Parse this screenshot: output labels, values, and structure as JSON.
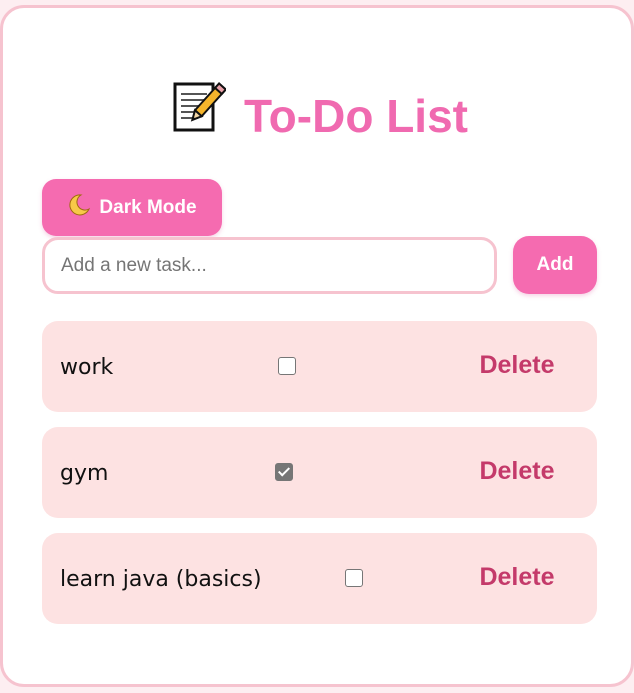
{
  "header": {
    "icon": "memo-icon",
    "title": "To-Do List"
  },
  "toolbar": {
    "dark_mode_icon": "crescent-moon-icon",
    "dark_mode_label": "Dark Mode"
  },
  "new_task": {
    "placeholder": "Add a new task...",
    "value": "",
    "add_label": "Add"
  },
  "tasks": [
    {
      "label": "work",
      "done": false,
      "delete_label": "Delete"
    },
    {
      "label": "gym",
      "done": true,
      "delete_label": "Delete"
    },
    {
      "label": "learn java (basics)",
      "done": false,
      "delete_label": "Delete"
    }
  ],
  "colors": {
    "accent": "#f56bb0",
    "title": "#f06ab0",
    "delete_text": "#c43a6a",
    "task_background": "#fde2e2",
    "border": "#f6c3cf"
  }
}
